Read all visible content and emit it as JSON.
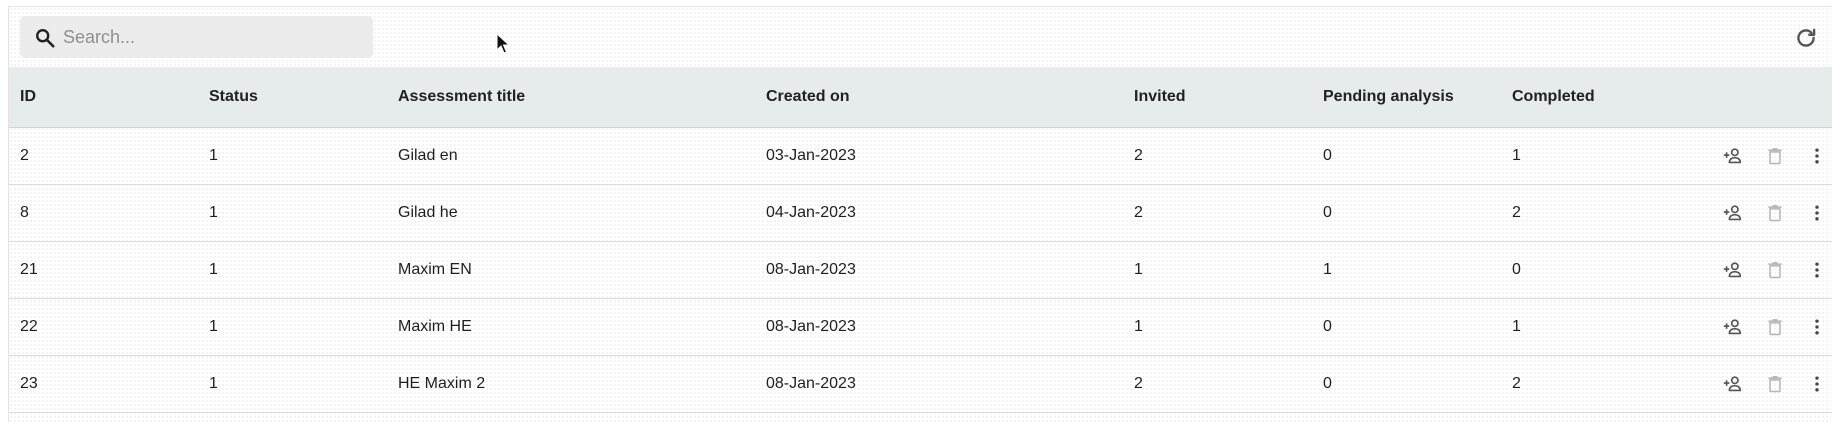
{
  "search": {
    "placeholder": "Search...",
    "value": ""
  },
  "toolbar": {
    "refresh_icon": "refresh-icon",
    "search_icon": "search-icon"
  },
  "table": {
    "columns": [
      "ID",
      "Status",
      "Assessment title",
      "Created on",
      "Invited",
      "Pending analysis",
      "Completed"
    ],
    "rows": [
      {
        "id": "2",
        "status": "1",
        "title": "Gilad en",
        "created": "03-Jan-2023",
        "invited": "2",
        "pending": "0",
        "completed": "1"
      },
      {
        "id": "8",
        "status": "1",
        "title": "Gilad he",
        "created": "04-Jan-2023",
        "invited": "2",
        "pending": "0",
        "completed": "2"
      },
      {
        "id": "21",
        "status": "1",
        "title": "Maxim EN",
        "created": "08-Jan-2023",
        "invited": "1",
        "pending": "1",
        "completed": "0"
      },
      {
        "id": "22",
        "status": "1",
        "title": "Maxim HE",
        "created": "08-Jan-2023",
        "invited": "1",
        "pending": "0",
        "completed": "1"
      },
      {
        "id": "23",
        "status": "1",
        "title": "HE Maxim 2",
        "created": "08-Jan-2023",
        "invited": "2",
        "pending": "0",
        "completed": "2"
      }
    ],
    "row_action_icons": [
      "person-add-icon",
      "trash-icon",
      "more-vert-icon"
    ]
  },
  "colors": {
    "header_bg": "#e6ebeb",
    "search_bg": "#ececec",
    "icon": "#555555",
    "icon_disabled": "#b5b5b5"
  }
}
